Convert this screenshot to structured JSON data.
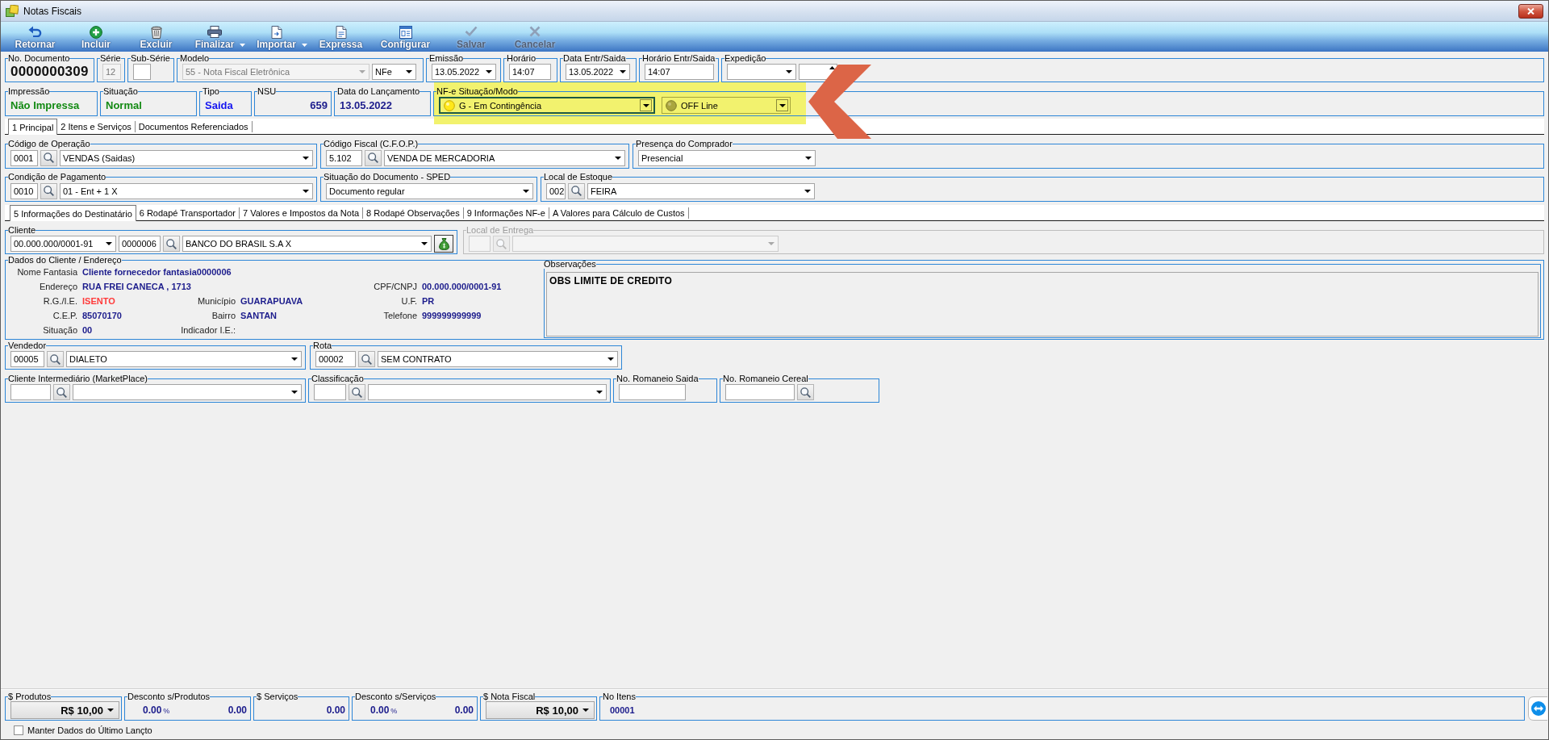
{
  "window": {
    "title": "Notas Fiscais"
  },
  "toolbar": [
    {
      "label": "Retornar",
      "disabled": false,
      "menu": false
    },
    {
      "label": "Incluir",
      "disabled": false,
      "menu": false
    },
    {
      "label": "Excluir",
      "disabled": false,
      "menu": false
    },
    {
      "label": "Finalizar",
      "disabled": false,
      "menu": true
    },
    {
      "label": "Importar",
      "disabled": false,
      "menu": true
    },
    {
      "label": "Expressa",
      "disabled": false,
      "menu": false
    },
    {
      "label": "Configurar",
      "disabled": false,
      "menu": false
    },
    {
      "label": "Salvar",
      "disabled": true,
      "menu": false
    },
    {
      "label": "Cancelar",
      "disabled": true,
      "menu": false
    }
  ],
  "header_rows": [
    [
      {
        "label": "No. Documento",
        "controls": [
          {
            "kind": "number",
            "value": "0000000309"
          }
        ]
      },
      {
        "label": "Série",
        "controls": [
          {
            "kind": "input",
            "value": "12",
            "disabled": true
          }
        ]
      },
      {
        "label": "Sub-Série",
        "controls": [
          {
            "kind": "input",
            "disabled": false
          }
        ]
      },
      {
        "label": "Modelo",
        "controls": [
          {
            "kind": "combo",
            "value": "55 - Nota Fiscal Eletrônica",
            "disabled": true
          },
          {
            "kind": "combo",
            "value": "NFe",
            "disabled": false
          }
        ]
      },
      {
        "label": "Emissão",
        "controls": [
          {
            "kind": "combo",
            "value": "13.05.2022"
          }
        ]
      },
      {
        "label": "Horário",
        "controls": [
          {
            "kind": "input",
            "value": "14:07"
          }
        ]
      },
      {
        "label": "Data Entr/Saida",
        "controls": [
          {
            "kind": "combo",
            "value": "13.05.2022"
          }
        ]
      },
      {
        "label": "Horário Entr/Saida",
        "controls": [
          {
            "kind": "input",
            "value": "14:07"
          }
        ]
      },
      {
        "label": "Expedição",
        "controls": [
          {
            "kind": "combo"
          },
          {
            "kind": "spin"
          }
        ]
      }
    ],
    [
      {
        "label": "Impressão",
        "highlighted": false,
        "controls": [
          {
            "kind": "display",
            "value": "Não Impressa",
            "color": "#138a13"
          }
        ]
      },
      {
        "label": "Situação",
        "highlighted": false,
        "controls": [
          {
            "kind": "display",
            "value": "Normal",
            "color": "#138a13"
          }
        ]
      },
      {
        "label": "Tipo",
        "highlighted": false,
        "controls": [
          {
            "kind": "display",
            "value": "Saida",
            "color": "#1414f0"
          }
        ]
      },
      {
        "label": "NSU",
        "highlighted": false,
        "controls": [
          {
            "kind": "display",
            "value": "659",
            "color": "#1c1c8c"
          }
        ]
      },
      {
        "label": "Data do Lançamento",
        "highlighted": false,
        "controls": [
          {
            "kind": "display",
            "value": "13.05.2022",
            "color": "#1c1c8c"
          }
        ]
      },
      {
        "label": "NF-e Situação/Modo",
        "highlighted": true,
        "controls": [
          {
            "kind": "status",
            "value": "G - Em Contingência",
            "on": true,
            "focused": true
          },
          {
            "kind": "status",
            "value": "OFF Line",
            "on": false,
            "focused": false
          }
        ]
      }
    ]
  ],
  "tabs": [
    {
      "label": "1 Principal",
      "selected": true
    },
    {
      "label": "2 Itens e Serviços",
      "selected": false
    },
    {
      "label": "Documentos Referenciados",
      "selected": false
    }
  ],
  "operation_rows": [
    [
      {
        "label": "Código de Operação",
        "controls": [
          {
            "kind": "input",
            "value": "0001"
          },
          {
            "kind": "lookup"
          },
          {
            "kind": "combo",
            "value": "VENDAS (Saidas)"
          }
        ]
      },
      {
        "label": "Código Fiscal (C.F.O.P.)",
        "controls": [
          {
            "kind": "input",
            "value": "5.102"
          },
          {
            "kind": "lookup"
          },
          {
            "kind": "combo",
            "value": "VENDA DE MERCADORIA"
          }
        ]
      },
      {
        "label": "Presença do Comprador",
        "controls": [
          {
            "kind": "combo",
            "value": "Presencial"
          }
        ]
      }
    ],
    [
      {
        "label": "Condição de Pagamento",
        "controls": [
          {
            "kind": "input",
            "value": "0010"
          },
          {
            "kind": "lookup"
          },
          {
            "kind": "combo",
            "value": "01 - Ent + 1 X"
          }
        ]
      },
      {
        "label": "Situação do Documento - SPED",
        "controls": [
          {
            "kind": "combo",
            "value": "Documento regular"
          }
        ]
      },
      {
        "label": "Local de Estoque",
        "controls": [
          {
            "kind": "input",
            "value": "002"
          },
          {
            "kind": "lookup"
          },
          {
            "kind": "combo",
            "value": "FEIRA"
          }
        ]
      }
    ]
  ],
  "subtabs": [
    {
      "label": "5 Informações do Destinatário",
      "selected": true
    },
    {
      "label": "6 Rodapé Transportador",
      "selected": false
    },
    {
      "label": "7 Valores e Impostos da Nota",
      "selected": false
    },
    {
      "label": "8 Rodapé Observações",
      "selected": false
    },
    {
      "label": "9 Informações NF-e",
      "selected": false
    },
    {
      "label": "A Valores para Cálculo de Custos",
      "selected": false
    }
  ],
  "recipient_row": [
    {
      "label": "Cliente",
      "disabled": false,
      "controls": [
        {
          "kind": "combo",
          "value": "00.000.000/0001-91",
          "disabled": false
        },
        {
          "kind": "input",
          "value": "0000006",
          "disabled": false
        },
        {
          "kind": "lookup",
          "disabled": false
        },
        {
          "kind": "combo",
          "value": "BANCO DO BRASIL S.A X",
          "disabled": false
        },
        {
          "kind": "icon-button",
          "disabled": false
        }
      ]
    },
    {
      "label": "Local de Entrega",
      "disabled": true,
      "controls": [
        {
          "kind": "input",
          "disabled": true
        },
        {
          "kind": "lookup",
          "disabled": true
        },
        {
          "kind": "combo",
          "disabled": true
        }
      ]
    }
  ],
  "client_data": {
    "label": "Dados do Cliente / Endereço",
    "rows": [
      [
        {
          "label": "Nome Fantasia",
          "value": "Cliente fornecedor fantasia0000006"
        }
      ],
      [
        {
          "label": "Endereço",
          "value": "RUA FREI CANECA , 1713"
        },
        null,
        {
          "label": "CPF/CNPJ",
          "value": "00.000.000/0001-91"
        }
      ],
      [
        {
          "label": "R.G./I.E.",
          "value": "ISENTO",
          "color": "#ff3a3a"
        },
        {
          "label": "Município",
          "value": "GUARAPUAVA"
        },
        {
          "label": "U.F.",
          "value": "PR"
        }
      ],
      [
        {
          "label": "C.E.P.",
          "value": "85070170"
        },
        {
          "label": "Bairro",
          "value": "SANTAN"
        },
        {
          "label": "Telefone",
          "value": "999999999999"
        }
      ],
      [
        {
          "label": "Situação",
          "value": "00"
        },
        {
          "label": "Indicador I.E.:"
        }
      ]
    ],
    "notes": {
      "label": "Observações",
      "value": "OBS LIMITE DE CREDITO"
    }
  },
  "sales_rows": [
    [
      {
        "label": "Vendedor",
        "controls": [
          {
            "kind": "input",
            "value": "00005"
          },
          {
            "kind": "lookup"
          },
          {
            "kind": "combo",
            "value": "DIALETO"
          }
        ]
      },
      {
        "label": "Rota",
        "controls": [
          {
            "kind": "input",
            "value": "00002"
          },
          {
            "kind": "lookup"
          },
          {
            "kind": "combo",
            "value": "SEM CONTRATO"
          }
        ]
      }
    ],
    [
      {
        "label": "Cliente Intermediário (MarketPlace)",
        "controls": [
          {
            "kind": "input"
          },
          {
            "kind": "lookup"
          },
          {
            "kind": "combo"
          }
        ]
      },
      {
        "label": "Classificação",
        "controls": [
          {
            "kind": "input"
          },
          {
            "kind": "lookup"
          },
          {
            "kind": "combo"
          }
        ]
      },
      {
        "label": "No. Romaneio Saida",
        "controls": [
          {
            "kind": "input"
          }
        ]
      },
      {
        "label": "No. Romaneio Cereal",
        "controls": [
          {
            "kind": "input"
          },
          {
            "kind": "lookup"
          }
        ]
      }
    ]
  ],
  "totals": [
    {
      "label": "$ Produtos",
      "kind": "menu-total",
      "value": "R$ 10,00"
    },
    {
      "label": "Desconto s/Produtos",
      "kind": "discount",
      "percent": "0.00",
      "unit": "%",
      "value": "0.00"
    },
    {
      "label": "$ Serviços",
      "kind": "amount",
      "value": "0.00"
    },
    {
      "label": "Desconto s/Serviços",
      "kind": "discount",
      "percent": "0.00",
      "unit": "%",
      "value": "0.00"
    },
    {
      "label": "$ Nota Fiscal",
      "kind": "menu-total",
      "value": "R$ 10,00"
    },
    {
      "label": "No Itens",
      "kind": "count",
      "value": "00001"
    }
  ],
  "keep_data": {
    "label": "Manter Dados do Último Lançto",
    "checked": false
  }
}
